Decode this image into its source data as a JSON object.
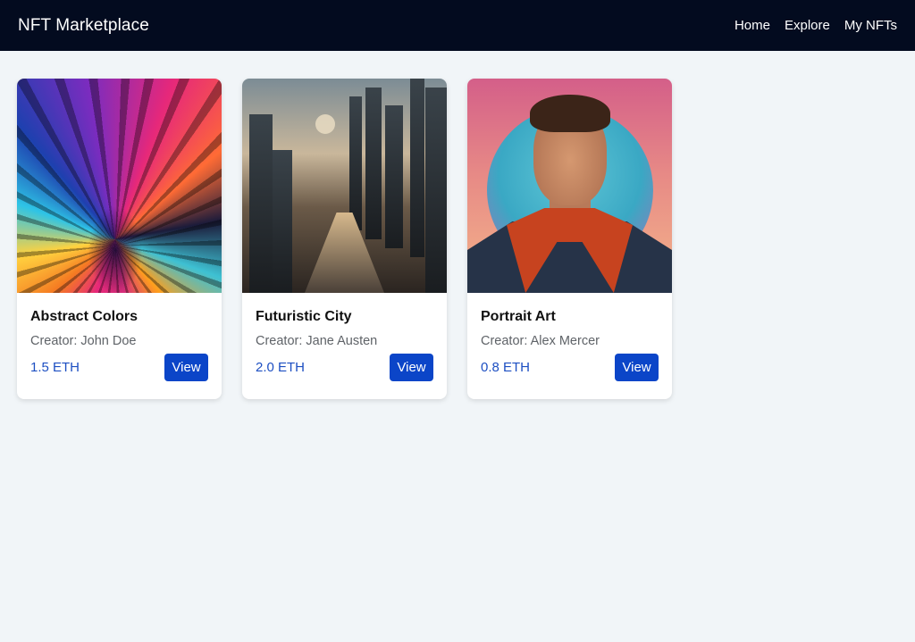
{
  "header": {
    "brand": "NFT Marketplace",
    "nav": [
      "Home",
      "Explore",
      "My NFTs"
    ]
  },
  "cards": [
    {
      "title": "Abstract Colors",
      "creator": "Creator: John Doe",
      "price": "1.5 ETH",
      "button": "View"
    },
    {
      "title": "Futuristic City",
      "creator": "Creator: Jane Austen",
      "price": "2.0 ETH",
      "button": "View"
    },
    {
      "title": "Portrait Art",
      "creator": "Creator: Alex Mercer",
      "price": "0.8 ETH",
      "button": "View"
    }
  ],
  "colors": {
    "navbar": "#030b1f",
    "page_background": "#f1f5f8",
    "accent": "#0b45c8",
    "price": "#1d4fc2"
  }
}
